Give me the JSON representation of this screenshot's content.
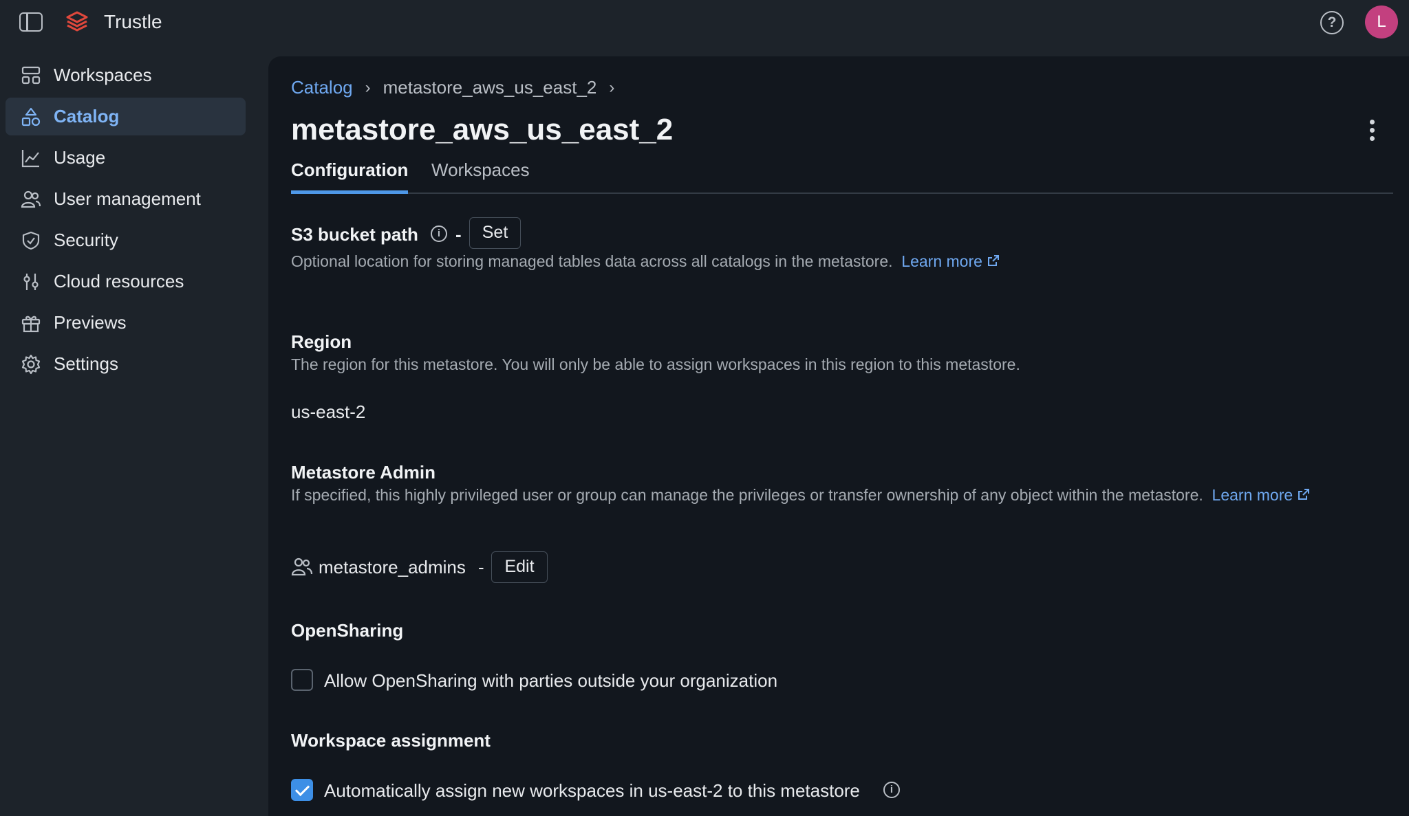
{
  "app": {
    "name": "Trustle",
    "avatar_initial": "L"
  },
  "sidebar": {
    "items": [
      {
        "label": "Workspaces",
        "icon": "workspaces-icon",
        "active": false
      },
      {
        "label": "Catalog",
        "icon": "catalog-icon",
        "active": true
      },
      {
        "label": "Usage",
        "icon": "usage-chart-icon",
        "active": false
      },
      {
        "label": "User management",
        "icon": "users-icon",
        "active": false
      },
      {
        "label": "Security",
        "icon": "shield-icon",
        "active": false
      },
      {
        "label": "Cloud resources",
        "icon": "cloud-resources-icon",
        "active": false
      },
      {
        "label": "Previews",
        "icon": "gift-icon",
        "active": false
      },
      {
        "label": "Settings",
        "icon": "gear-icon",
        "active": false
      }
    ]
  },
  "breadcrumb": {
    "root": "Catalog",
    "separator": "›",
    "current": "metastore_aws_us_east_2"
  },
  "page": {
    "title": "metastore_aws_us_east_2"
  },
  "tabs": [
    {
      "label": "Configuration",
      "active": true
    },
    {
      "label": "Workspaces",
      "active": false
    }
  ],
  "s3": {
    "title": "S3 bucket path",
    "dash": "-",
    "set_label": "Set",
    "description": "Optional location for storing managed tables data across all catalogs in the metastore.",
    "learn_more": "Learn more"
  },
  "region": {
    "title": "Region",
    "description": "The region for this metastore. You will only be able to assign workspaces in this region to this metastore.",
    "value": "us-east-2"
  },
  "admin": {
    "title": "Metastore Admin",
    "description": "If specified, this highly privileged user or group can manage the privileges or transfer ownership of any object within the metastore.",
    "learn_more_1": "Learn",
    "learn_more_2": "more",
    "group": "metastore_admins",
    "dash": "-",
    "edit_label": "Edit"
  },
  "opensharing": {
    "title": "OpenSharing",
    "checkbox_label": "Allow OpenSharing with parties outside your organization",
    "checked": false
  },
  "assignment": {
    "title": "Workspace assignment",
    "checkbox_label": "Automatically assign new workspaces in us-east-2 to this metastore",
    "checked": true
  },
  "colors": {
    "accent": "#4e98e8",
    "link": "#6fa8f0",
    "avatar": "#c3407f",
    "sidebar_bg": "#1d232a",
    "content_bg": "#12171e"
  }
}
